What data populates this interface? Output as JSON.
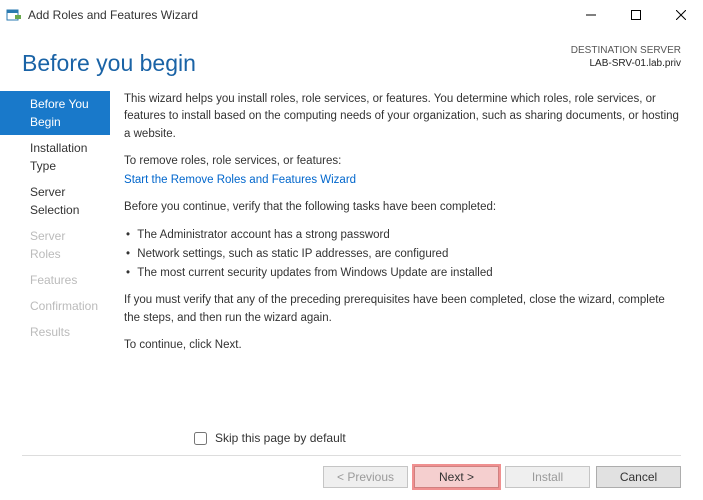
{
  "window": {
    "title": "Add Roles and Features Wizard"
  },
  "header": {
    "pageTitle": "Before you begin",
    "destinationLabel": "DESTINATION SERVER",
    "destinationValue": "LAB-SRV-01.lab.priv"
  },
  "sidebar": {
    "items": [
      {
        "label": "Before You Begin",
        "state": "selected"
      },
      {
        "label": "Installation Type",
        "state": "enabled"
      },
      {
        "label": "Server Selection",
        "state": "enabled"
      },
      {
        "label": "Server Roles",
        "state": "disabled"
      },
      {
        "label": "Features",
        "state": "disabled"
      },
      {
        "label": "Confirmation",
        "state": "disabled"
      },
      {
        "label": "Results",
        "state": "disabled"
      }
    ]
  },
  "content": {
    "intro1": "This wizard helps you install roles, role services, or features. You determine which roles, role services, or features to install based on the computing needs of your organization, such as sharing documents, or hosting a website.",
    "removeLine": "To remove roles, role services, or features:",
    "removeLink": "Start the Remove Roles and Features Wizard",
    "verifyLine": "Before you continue, verify that the following tasks have been completed:",
    "bullet1": "The Administrator account has a strong password",
    "bullet2": "Network settings, such as static IP addresses, are configured",
    "bullet3": "The most current security updates from Windows Update are installed",
    "closeNote": "If you must verify that any of the preceding prerequisites have been completed, close the wizard, complete the steps, and then run the wizard again.",
    "continueNote": "To continue, click Next."
  },
  "footer": {
    "skipLabel": "Skip this page by default",
    "previous": "< Previous",
    "next": "Next >",
    "install": "Install",
    "cancel": "Cancel"
  }
}
